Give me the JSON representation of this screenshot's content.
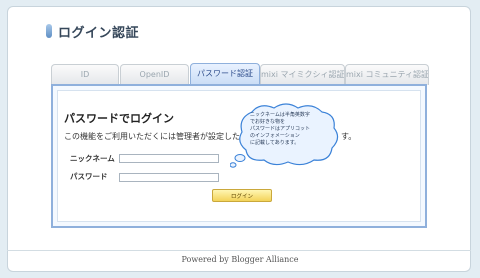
{
  "header": {
    "title": "ログイン認証"
  },
  "tabs": [
    {
      "label": "ID",
      "active": false
    },
    {
      "label": "OpenID",
      "active": false
    },
    {
      "label": "パスワード認証",
      "active": true
    },
    {
      "label": "mixi マイミクシィ認証",
      "active": false
    },
    {
      "label": "mixi コミュニティ認証",
      "active": false
    }
  ],
  "main": {
    "heading": "パスワードでログイン",
    "description": "この機能をご利用いただくには管理者が設定した",
    "description_tail": "す。",
    "nickname_label": "ニックネーム",
    "nickname_value": "",
    "password_label": "パスワード",
    "password_value": "",
    "login_button": "ログイン"
  },
  "tooltip": {
    "lines": [
      "ニックネームは半角英数字",
      "でお好きな物を",
      "パスワードはアプリコット",
      "のインフォメーション",
      "に記載してあります。"
    ]
  },
  "footer": {
    "text": "Powered by Blogger Alliance"
  },
  "colors": {
    "accent": "#8fb0dc",
    "button": "#f3d35a",
    "background": "#e3edf3"
  }
}
